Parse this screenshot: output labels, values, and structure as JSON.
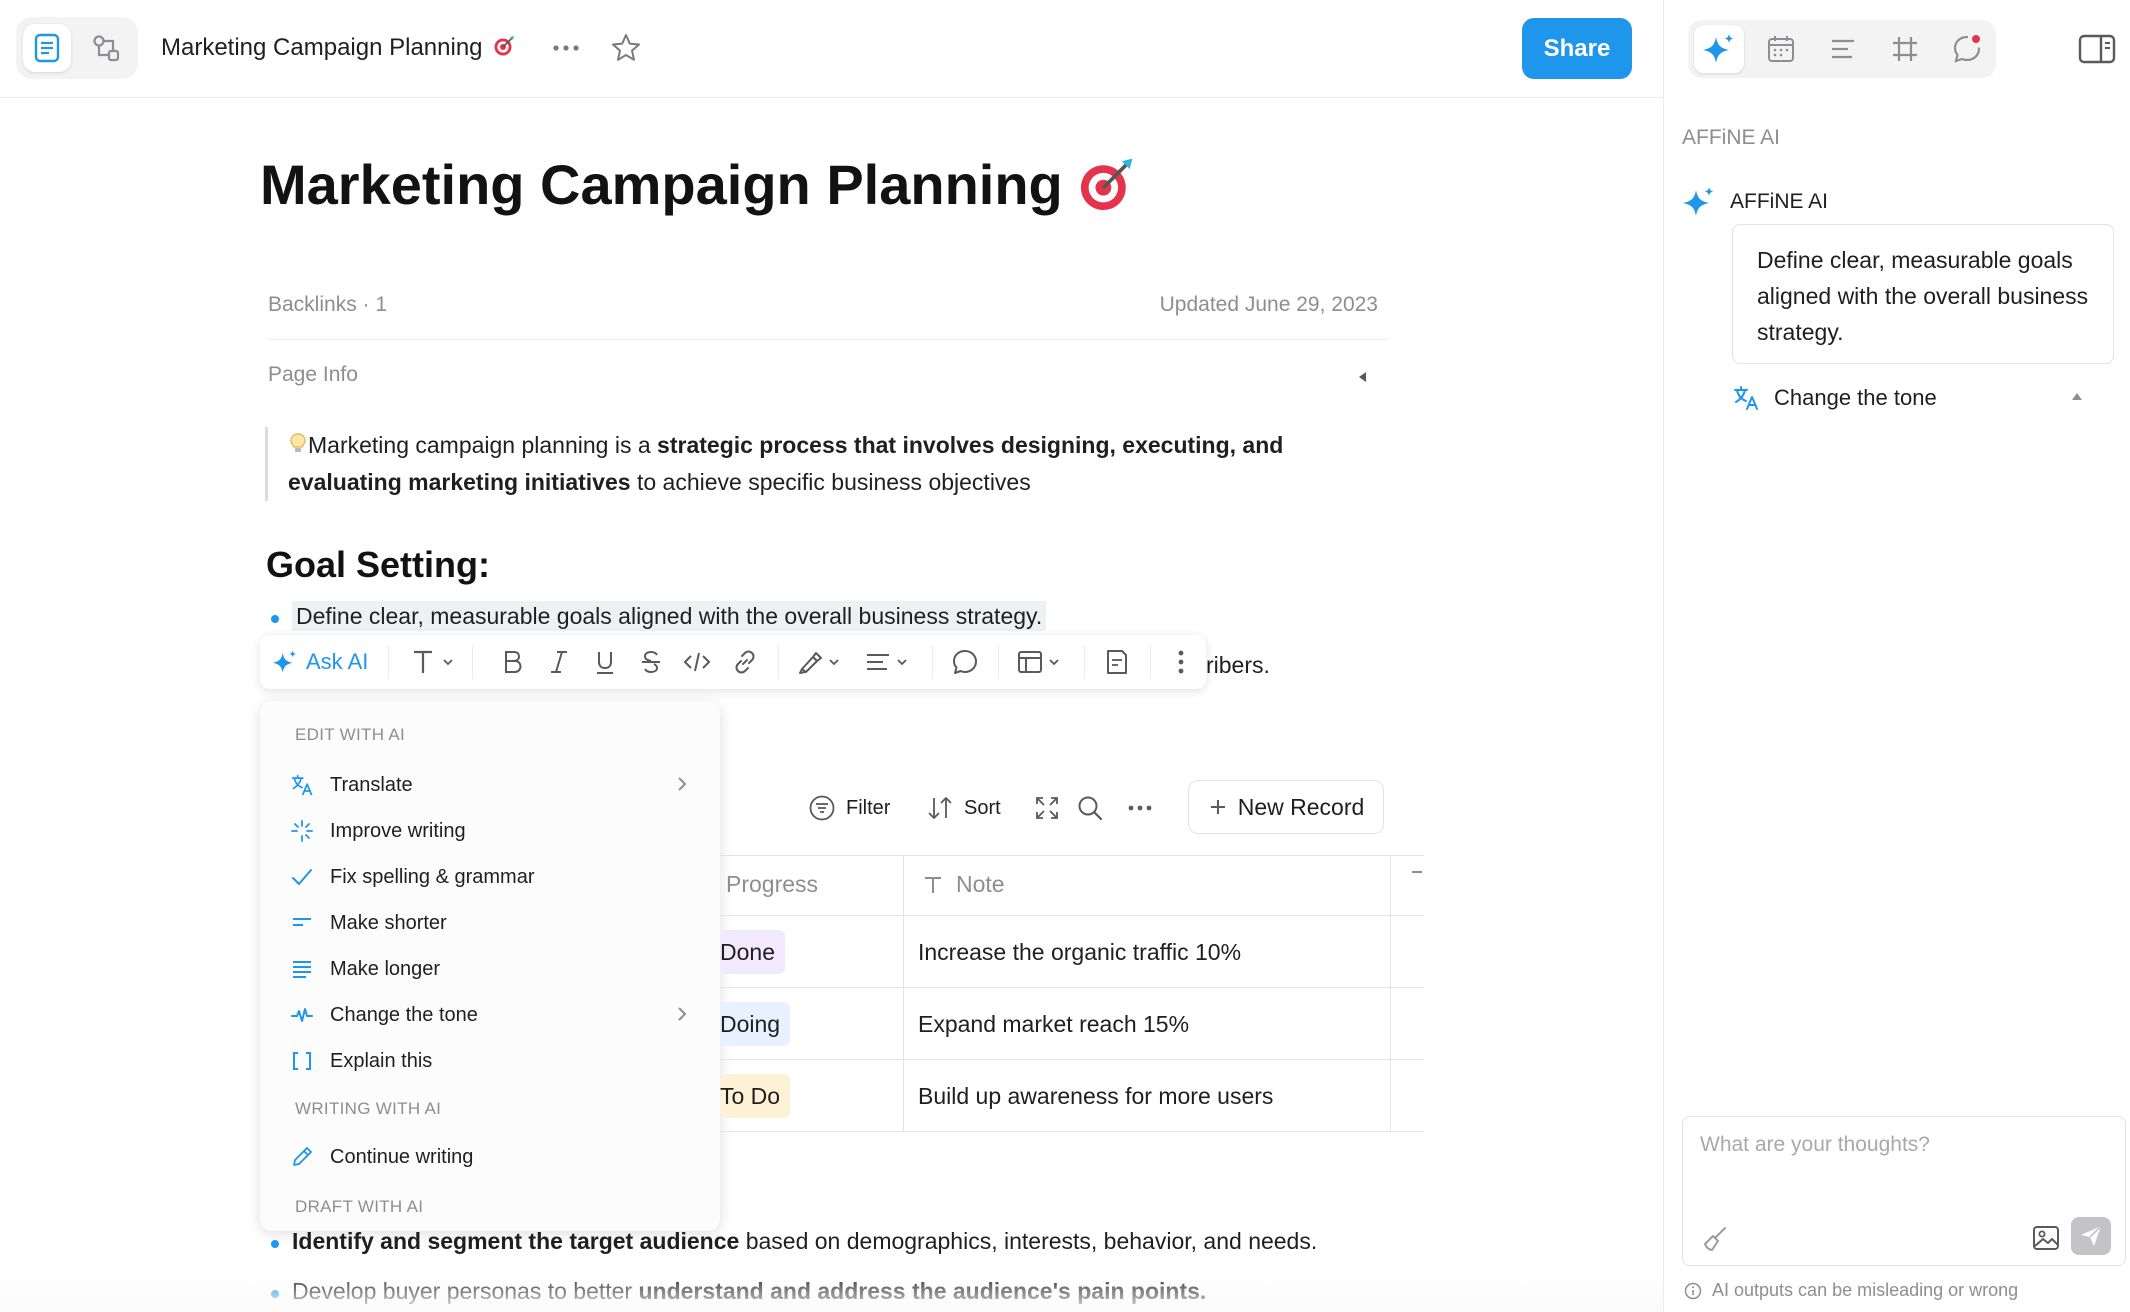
{
  "topbar": {
    "doc_title": "Marketing Campaign Planning",
    "share_label": "Share"
  },
  "right_panel": {
    "heading": "AFFiNE AI",
    "ai_name": "AFFiNE AI",
    "quoted_text": "Define clear, measurable goals aligned with the overall business strategy.",
    "action_label": "Change the tone",
    "chat_placeholder": "What are your thoughts?",
    "warning": "AI outputs can be misleading or wrong"
  },
  "doc": {
    "title": "Marketing Campaign Planning",
    "backlinks": "Backlinks · 1",
    "updated": "Updated June 29, 2023",
    "page_info": "Page Info",
    "quote_intro": "Marketing campaign planning is a ",
    "quote_bold": "strategic process that involves designing, executing, and evaluating marketing initiatives",
    "quote_tail": " to achieve specific business objectives",
    "goal_heading": "Goal Setting:",
    "bullet_1": "Define clear, measurable goals aligned with the overall business strategy.",
    "bullet_2_tail": "ribers.",
    "bullet_3_bold": "Identify and segment the target audience",
    "bullet_3_tail": " based on demographics, interests, behavior, and needs.",
    "bullet_4_intro": "Develop buyer personas to better ",
    "bullet_4_bold": "understand and address the audience's pain points."
  },
  "toolbar": {
    "ask_ai": "Ask AI"
  },
  "ai_menu": {
    "section_edit": "EDIT WITH AI",
    "section_writing": "WRITING WITH AI",
    "section_draft": "DRAFT WITH AI",
    "items": [
      {
        "label": "Translate",
        "icon": "translate-icon",
        "submenu": true
      },
      {
        "label": "Improve writing",
        "icon": "sparkle-icon",
        "submenu": false
      },
      {
        "label": "Fix spelling & grammar",
        "icon": "check-icon",
        "submenu": false
      },
      {
        "label": "Make shorter",
        "icon": "short-lines-icon",
        "submenu": false
      },
      {
        "label": "Make longer",
        "icon": "long-lines-icon",
        "submenu": false
      },
      {
        "label": "Change the tone",
        "icon": "pulse-icon",
        "submenu": true
      },
      {
        "label": "Explain this",
        "icon": "brackets-icon",
        "submenu": false
      }
    ],
    "continue_writing": "Continue writing"
  },
  "database": {
    "filter": "Filter",
    "sort": "Sort",
    "new_record": "New Record",
    "col_progress": "Progress",
    "col_note": "Note",
    "rows": [
      {
        "progress": "Done",
        "note": "Increase the organic traffic 10%",
        "tag_color": "#f3e9ff"
      },
      {
        "progress": "Doing",
        "note": "Expand market reach 15%",
        "tag_color": "#e6f2ff"
      },
      {
        "progress": "To Do",
        "note": "Build up awareness for more users",
        "tag_color": "#fff1d6"
      }
    ]
  },
  "colors": {
    "accent": "#1e96eb",
    "text": "#1f1f1f",
    "muted": "#8e8d91"
  }
}
